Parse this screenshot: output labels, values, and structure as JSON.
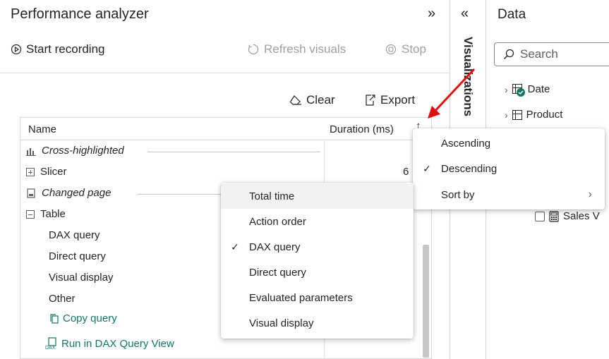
{
  "perf": {
    "title": "Performance analyzer",
    "collapse_icon": "»",
    "start_recording": "Start recording",
    "refresh_visuals": "Refresh visuals",
    "stop": "Stop",
    "clear": "Clear",
    "export": "Export"
  },
  "results": {
    "col_name": "Name",
    "col_duration": "Duration (ms)",
    "sort_arrow": "↑",
    "rows": [
      {
        "label": "Cross-highlighted"
      },
      {
        "label": "Slicer",
        "duration": "6"
      },
      {
        "label": "Changed page"
      },
      {
        "label": "Table"
      },
      {
        "label": "DAX query"
      },
      {
        "label": "Direct query"
      },
      {
        "label": "Visual display"
      },
      {
        "label": "Other"
      }
    ],
    "copy_query": "Copy query",
    "run_dax": "Run in DAX Query View"
  },
  "viz": {
    "expand_icon": "«",
    "label": "Visualizations"
  },
  "data_pane": {
    "title": "Data",
    "search_placeholder": "Search",
    "items": [
      "Date",
      "Product"
    ],
    "sales_item": "Sales V"
  },
  "sort_menu": {
    "items": [
      "Ascending",
      "Descending",
      "Sort by"
    ],
    "checked": "Descending"
  },
  "sortby_menu": {
    "items": [
      "Total time",
      "Action order",
      "DAX query",
      "Direct query",
      "Evaluated parameters",
      "Visual display"
    ],
    "checked": "DAX query",
    "highlighted": "Total time"
  },
  "colors": {
    "link": "#117865",
    "arrow": "#e01010"
  }
}
